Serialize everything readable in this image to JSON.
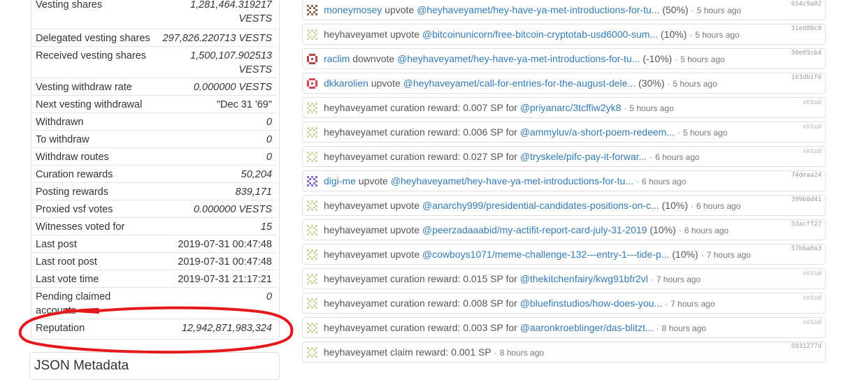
{
  "props": [
    {
      "key": "Vesting shares",
      "value": "1,281,464.319217 VESTS",
      "italic": true
    },
    {
      "key": "Delegated vesting shares",
      "value": "297,826.220713 VESTS",
      "italic": true
    },
    {
      "key": "Received vesting shares",
      "value": "1,500,107.902513 VESTS",
      "italic": true
    },
    {
      "key": "Vesting withdraw rate",
      "value": "0.000000 VESTS",
      "italic": true
    },
    {
      "key": "Next vesting withdrawal",
      "value": "\"Dec 31 '69\"",
      "italic": false
    },
    {
      "key": "Withdrawn",
      "value": "0",
      "italic": true
    },
    {
      "key": "To withdraw",
      "value": "0",
      "italic": true
    },
    {
      "key": "Withdraw routes",
      "value": "0",
      "italic": true
    },
    {
      "key": "Curation rewards",
      "value": "50,204",
      "italic": true
    },
    {
      "key": "Posting rewards",
      "value": "839,171",
      "italic": true
    },
    {
      "key": "Proxied vsf votes",
      "value": "0.000000 VESTS",
      "italic": true
    },
    {
      "key": "Witnesses voted for",
      "value": "15",
      "italic": true
    },
    {
      "key": "Last post",
      "value": "2019-07-31 00:47:48",
      "italic": false
    },
    {
      "key": "Last root post",
      "value": "2019-07-31 00:47:48",
      "italic": false
    },
    {
      "key": "Last vote time",
      "value": "2019-07-31 21:17:21",
      "italic": false
    },
    {
      "key": "Pending claimed accounts",
      "value": "0",
      "italic": true
    },
    {
      "key": "Reputation",
      "value": "12,942,871,983,324",
      "italic": true
    }
  ],
  "json_metadata_title": "JSON Metadata",
  "annotation_color": "#e3191c",
  "link_color": "#337ab7",
  "ops": [
    {
      "actor": "moneymosey",
      "verb": " upvote ",
      "link": "@heyhaveyamet/hey-have-ya-met-introductions-for-tu...",
      "suffix": " (50%)",
      "time": "5 hours ago",
      "hash": "654c9a82",
      "icon": "identicon-moneymosey",
      "actor_link": true
    },
    {
      "actor": "heyhaveyamet",
      "verb": " upvote ",
      "link": "@bitcoinunicorn/free-bitcoin-cryptotab-usd6000-sum...",
      "suffix": " (10%)",
      "time": "5 hours ago",
      "hash": "31ed88c0",
      "icon": "identicon-heyhaveyamet",
      "actor_link": false
    },
    {
      "actor": "raclim",
      "verb": " downvote ",
      "link": "@heyhaveyamet/hey-have-ya-met-introductions-for-tu...",
      "suffix": " (-10%)",
      "time": "5 hours ago",
      "hash": "50e05cb4",
      "icon": "identicon-raclim",
      "actor_link": true
    },
    {
      "actor": "dkkarolien",
      "verb": " upvote ",
      "link": "@heyhaveyamet/call-for-entries-for-the-august-dele...",
      "suffix": " (30%)",
      "time": "5 hours ago",
      "hash": "163db1f6",
      "icon": "identicon-dkkarolien",
      "actor_link": true
    },
    {
      "actor": "heyhaveyamet",
      "verb": " curation reward: 0.007 SP for ",
      "link": "@priyanarc/3tcffiw2yk8",
      "suffix": "",
      "time": "5 hours ago",
      "hash": "virtual",
      "icon": "identicon-heyhaveyamet",
      "actor_link": false
    },
    {
      "actor": "heyhaveyamet",
      "verb": " curation reward: 0.006 SP for ",
      "link": "@ammyluv/a-short-poem-redeem...",
      "suffix": "",
      "time": "5 hours ago",
      "hash": "virtual",
      "icon": "identicon-heyhaveyamet",
      "actor_link": false
    },
    {
      "actor": "heyhaveyamet",
      "verb": " curation reward: 0.027 SP for ",
      "link": "@tryskele/pifc-pay-it-forwar...",
      "suffix": "",
      "time": "6 hours ago",
      "hash": "virtual",
      "icon": "identicon-heyhaveyamet",
      "actor_link": false
    },
    {
      "actor": "digi-me",
      "verb": " upvote ",
      "link": "@heyhaveyamet/hey-have-ya-met-introductions-for-tu...",
      "suffix": "",
      "time": "6 hours ago",
      "hash": "74deaa24",
      "icon": "identicon-digi-me",
      "actor_link": true
    },
    {
      "actor": "heyhaveyamet",
      "verb": " upvote ",
      "link": "@anarchy999/presidential-candidates-positions-on-c...",
      "suffix": " (10%)",
      "time": "6 hours ago",
      "hash": "39968d41",
      "icon": "identicon-heyhaveyamet",
      "actor_link": false
    },
    {
      "actor": "heyhaveyamet",
      "verb": " upvote ",
      "link": "@peerzadaaabid/my-actifit-report-card-july-31-2019",
      "suffix": " (10%)",
      "time": "6 hours ago",
      "hash": "53acff27",
      "icon": "identicon-heyhaveyamet",
      "actor_link": false
    },
    {
      "actor": "heyhaveyamet",
      "verb": " upvote ",
      "link": "@cowboys1071/meme-challenge-132---entry-1---tide-p...",
      "suffix": " (10%)",
      "time": "7 hours ago",
      "hash": "57b6a8a3",
      "icon": "identicon-heyhaveyamet",
      "actor_link": false
    },
    {
      "actor": "heyhaveyamet",
      "verb": " curation reward: 0.015 SP for ",
      "link": "@thekitchenfairy/kwg91bfr2vl",
      "suffix": "",
      "time": "7 hours ago",
      "hash": "virtual",
      "icon": "identicon-heyhaveyamet",
      "actor_link": false
    },
    {
      "actor": "heyhaveyamet",
      "verb": " curation reward: 0.008 SP for ",
      "link": "@bluefinstudios/how-does-you...",
      "suffix": "",
      "time": "7 hours ago",
      "hash": "virtual",
      "icon": "identicon-heyhaveyamet",
      "actor_link": false
    },
    {
      "actor": "heyhaveyamet",
      "verb": " curation reward: 0.003 SP for ",
      "link": "@aaronkroeblinger/das-blitzt...",
      "suffix": "",
      "time": "8 hours ago",
      "hash": "virtual",
      "icon": "identicon-heyhaveyamet",
      "actor_link": false
    },
    {
      "actor": "heyhaveyamet",
      "verb": " claim reward: 0.001 SP",
      "link": "",
      "suffix": "",
      "time": "8 hours ago",
      "hash": "5931277d",
      "icon": "identicon-heyhaveyamet",
      "actor_link": false
    }
  ],
  "separator": "·"
}
